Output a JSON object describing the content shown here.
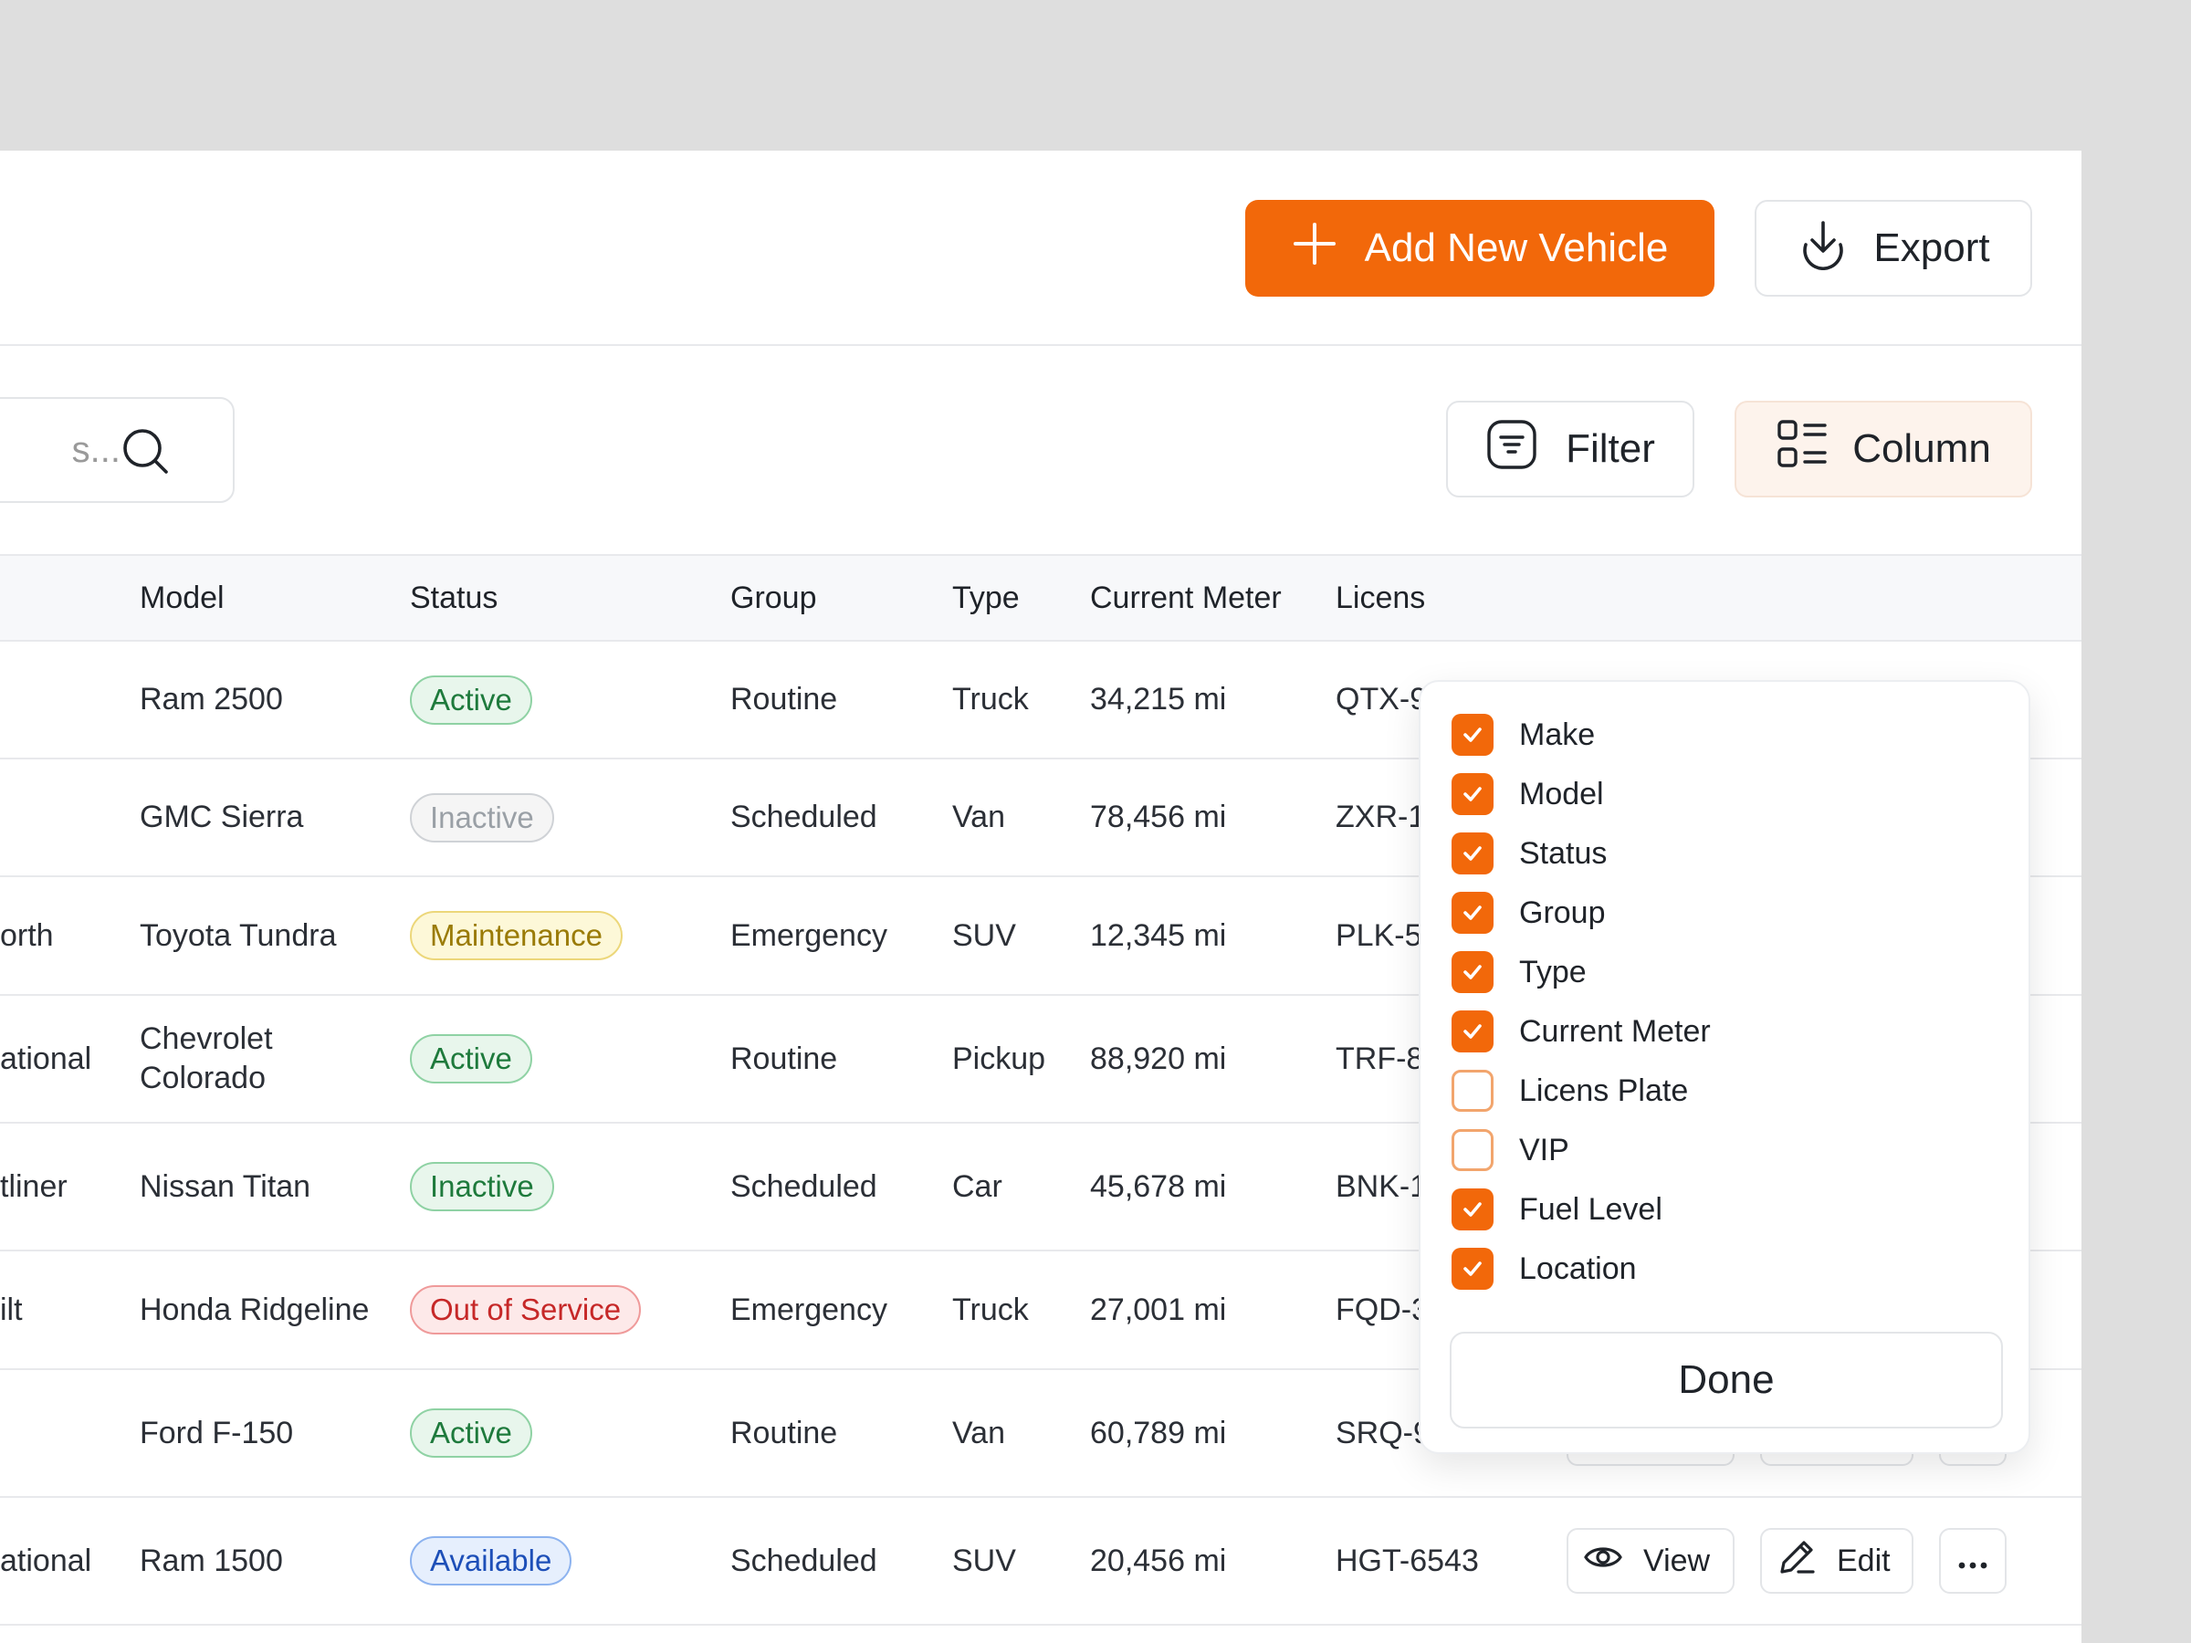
{
  "header": {
    "add_button_label": "Add New Vehicle",
    "export_button_label": "Export"
  },
  "toolbar": {
    "search_placeholder": "s...",
    "filter_label": "Filter",
    "column_label": "Column"
  },
  "table": {
    "columns": [
      "Model",
      "Status",
      "Group",
      "Type",
      "Current Meter",
      "Licens"
    ],
    "rows": [
      {
        "name": "",
        "model": "Ram 2500",
        "status": "Active",
        "group": "Routine",
        "type": "Truck",
        "meter": "34,215 mi",
        "plate": "QTX-9"
      },
      {
        "name": "",
        "model": "GMC Sierra",
        "status": "Inactive",
        "group": "Scheduled",
        "type": "Van",
        "meter": "78,456 mi",
        "plate": "ZXR-1"
      },
      {
        "name": "orth",
        "model": "Toyota Tundra",
        "status": "Maintenance",
        "group": "Emergency",
        "type": "SUV",
        "meter": "12,345 mi",
        "plate": "PLK-5"
      },
      {
        "name": "ational",
        "model": "Chevrolet Colorado",
        "status": "Active",
        "group": "Routine",
        "type": "Pickup",
        "meter": "88,920 mi",
        "plate": "TRF-8"
      },
      {
        "name": "tliner",
        "model": "Nissan Titan",
        "status": "Inactive",
        "group": "Scheduled",
        "type": "Car",
        "meter": "45,678 mi",
        "plate": "BNK-1"
      },
      {
        "name": "ilt",
        "model": "Honda Ridgeline",
        "status": "Out of Service",
        "group": "Emergency",
        "type": "Truck",
        "meter": "27,001 mi",
        "plate": "FQD-3345"
      },
      {
        "name": "",
        "model": "Ford F-150",
        "status": "Active",
        "group": "Routine",
        "type": "Van",
        "meter": "60,789 mi",
        "plate": "SRQ-9876"
      },
      {
        "name": "ational",
        "model": "Ram 1500",
        "status": "Available",
        "group": "Scheduled",
        "type": "SUV",
        "meter": "20,456 mi",
        "plate": "HGT-6543"
      }
    ],
    "actions": {
      "view": "View",
      "edit": "Edit"
    }
  },
  "column_menu": {
    "options": [
      {
        "label": "Make",
        "checked": true
      },
      {
        "label": "Model",
        "checked": true
      },
      {
        "label": "Status",
        "checked": true
      },
      {
        "label": "Group",
        "checked": true
      },
      {
        "label": "Type",
        "checked": true
      },
      {
        "label": "Current Meter",
        "checked": true
      },
      {
        "label": "Licens Plate",
        "checked": false
      },
      {
        "label": "VIP",
        "checked": false
      },
      {
        "label": "Fuel Level",
        "checked": true
      },
      {
        "label": "Location",
        "checked": true
      }
    ],
    "done_label": "Done"
  },
  "colors": {
    "accent": "#f2680a",
    "background": "#dedede"
  }
}
